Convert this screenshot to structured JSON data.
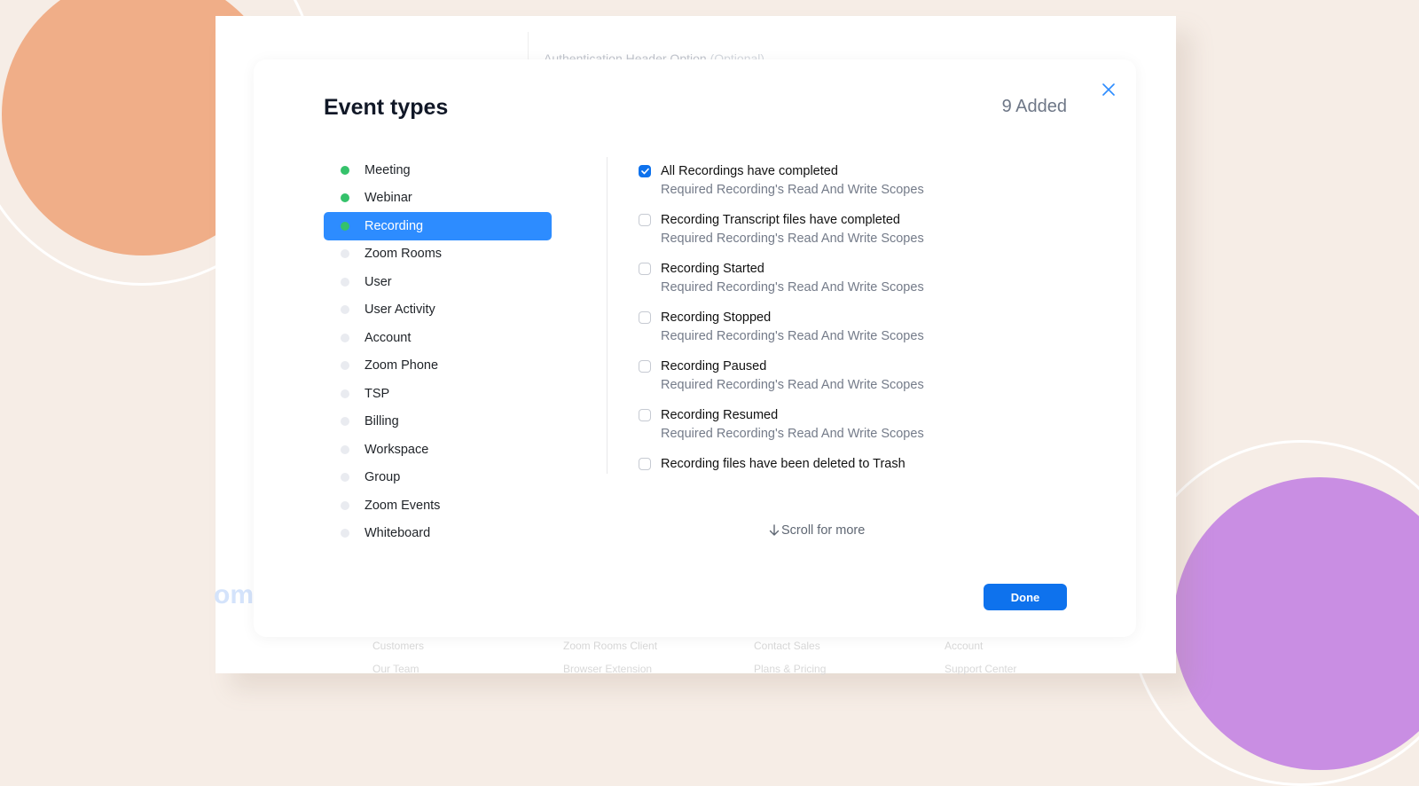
{
  "background_colors": {
    "page": "#f6ede6",
    "blob_top_left": "#f0ae88",
    "blob_bottom_right": "#c98ee3"
  },
  "background_app": {
    "auth_header_option_label": "Authentication Header Option",
    "auth_header_option_optional": "(Optional)",
    "logo_fragment": "om",
    "footer_links": [
      "Customers",
      "Our Team",
      "Zoom Rooms Client",
      "Browser Extension",
      "Contact Sales",
      "Plans & Pricing",
      "Account",
      "Support Center"
    ]
  },
  "modal": {
    "title": "Event types",
    "added_count": "9 Added",
    "close_icon": "close-icon",
    "categories": [
      {
        "label": "Meeting",
        "has_selection": true
      },
      {
        "label": "Webinar",
        "has_selection": true
      },
      {
        "label": "Recording",
        "has_selection": true,
        "active": true
      },
      {
        "label": "Zoom Rooms",
        "has_selection": false
      },
      {
        "label": "User",
        "has_selection": false
      },
      {
        "label": "User Activity",
        "has_selection": false
      },
      {
        "label": "Account",
        "has_selection": false
      },
      {
        "label": "Zoom Phone",
        "has_selection": false
      },
      {
        "label": "TSP",
        "has_selection": false
      },
      {
        "label": "Billing",
        "has_selection": false
      },
      {
        "label": "Workspace",
        "has_selection": false
      },
      {
        "label": "Group",
        "has_selection": false
      },
      {
        "label": "Zoom Events",
        "has_selection": false
      },
      {
        "label": "Whiteboard",
        "has_selection": false
      }
    ],
    "events": [
      {
        "title": "All Recordings have completed",
        "subtitle": "Required Recording's Read And Write Scopes",
        "checked": true
      },
      {
        "title": "Recording Transcript files have completed",
        "subtitle": "Required Recording's Read And Write Scopes",
        "checked": false
      },
      {
        "title": "Recording Started",
        "subtitle": "Required Recording's Read And Write Scopes",
        "checked": false
      },
      {
        "title": "Recording Stopped",
        "subtitle": "Required Recording's Read And Write Scopes",
        "checked": false
      },
      {
        "title": "Recording Paused",
        "subtitle": "Required Recording's Read And Write Scopes",
        "checked": false
      },
      {
        "title": "Recording Resumed",
        "subtitle": "Required Recording's Read And Write Scopes",
        "checked": false
      },
      {
        "title": "Recording files have been deleted to Trash",
        "subtitle": "",
        "checked": false
      }
    ],
    "scroll_hint": "Scroll for more",
    "scroll_icon": "arrow-down-icon",
    "done_label": "Done",
    "accent_color": "#0e72ed",
    "active_category_color": "#2d8cff",
    "selected_dot_color": "#35c26b"
  }
}
